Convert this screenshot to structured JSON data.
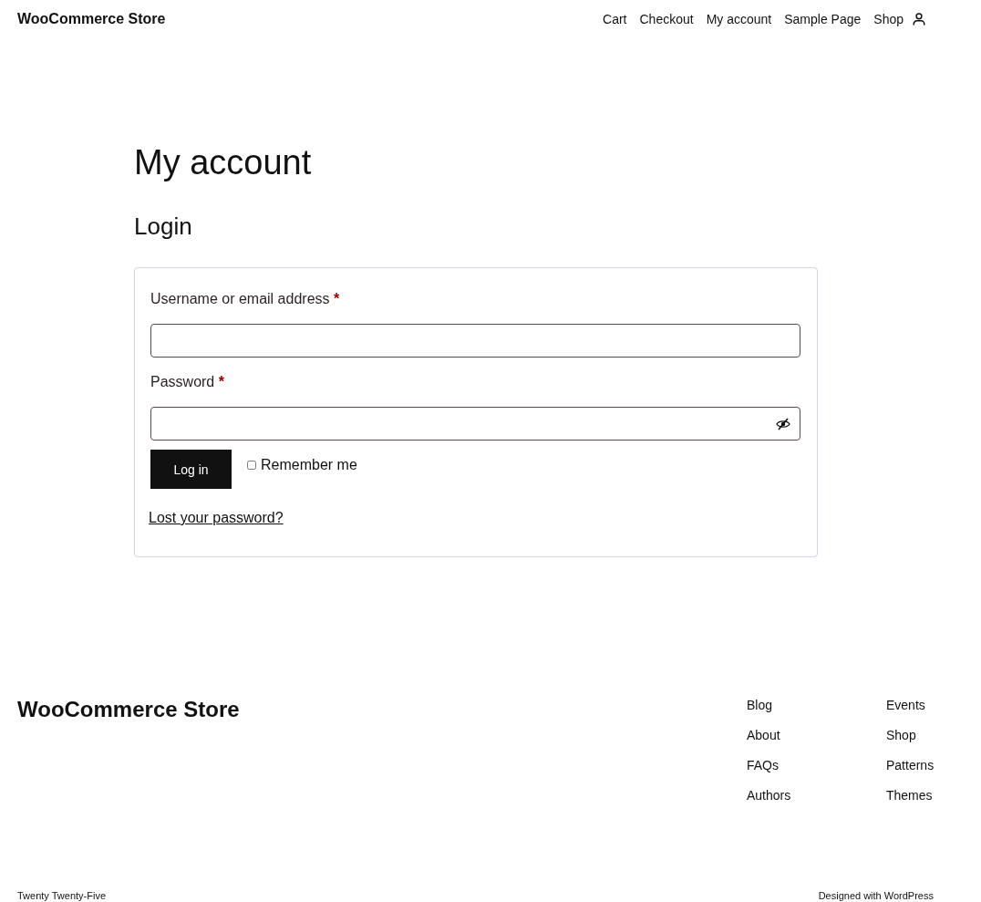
{
  "header": {
    "site_title": "WooCommerce Store",
    "nav": [
      "Cart",
      "Checkout",
      "My account",
      "Sample Page",
      "Shop"
    ]
  },
  "page": {
    "title": "My account",
    "heading": "Login"
  },
  "login_form": {
    "fields": [
      {
        "label": "Username or email address",
        "required_mark": "*",
        "kind": "text"
      },
      {
        "label": "Password",
        "required_mark": "*",
        "kind": "password"
      }
    ],
    "submit": "Log in",
    "remember": {
      "label": "Remember me",
      "checked": false
    },
    "lost_password": "Lost your password?"
  },
  "footer": {
    "site_title": "WooCommerce Store",
    "columns": [
      [
        "Blog",
        "About",
        "FAQs",
        "Authors"
      ],
      [
        "Events",
        "Shop",
        "Patterns",
        "Themes"
      ]
    ],
    "credit_left": "Twenty Twenty-Five",
    "credit_right": "Designed with WordPress"
  }
}
